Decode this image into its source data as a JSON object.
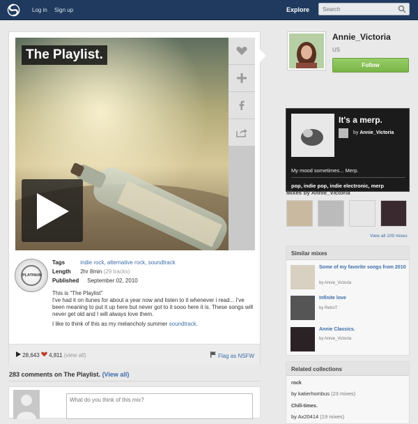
{
  "nav": {
    "login": "Log in",
    "signup": "Sign up",
    "explore": "Explore",
    "search_placeholder": "Search"
  },
  "mix": {
    "title": "The Playlist.",
    "tags_label": "Tags",
    "tags": "indie rock, alternative rock, soundtrack",
    "length_label": "Length",
    "length": "2hr 8min",
    "tracks": "(29 tracks)",
    "published_label": "Published",
    "published": "September 02, 2010",
    "badge": "PLATINUM",
    "desc1": "This is \"The Playlist\"",
    "desc2": "I've had it on itunes for about a year now and listen to it whenever i read... I've been meaning to put it up here but never got to it sooo here it is. These songs will never get old and I will always love them.",
    "desc3_pre": "I like to think of this as my melancholy summer ",
    "desc3_link": "soundtrack",
    "plays": "28,643",
    "likes": "4,811",
    "view_all": "(view all)",
    "flag": "Flag as NSFW"
  },
  "comments": {
    "heading": "283 comments on The Playlist.",
    "view_all": "(View all)",
    "placeholder": "What do you think of this mix?"
  },
  "profile": {
    "name": "Annie_Victoria",
    "location": "US",
    "follow": "Follow"
  },
  "card": {
    "title": "It's a merp.",
    "by": "by",
    "user": "Annie_Victoria",
    "desc": "My mood sometimes... Merp.",
    "tags": "pop, indie pop, indie electronic, merp"
  },
  "mixes_by": {
    "heading": "Mixes by Annie_Victoria",
    "view_all": "View all 109 mixes"
  },
  "similar": {
    "heading": "Similar mixes",
    "items": [
      {
        "title": "Some of my favorite songs from 2010",
        "by": "by Annie_Victoria"
      },
      {
        "title": "Infinite love",
        "by": "by RetroT"
      },
      {
        "title": "Annie Classics.",
        "by": "by Annie_Victoria"
      }
    ]
  },
  "collections": {
    "heading": "Related collections",
    "items": [
      {
        "name": "rock",
        "by": "by katierhombus",
        "count": "(23 mixes)"
      },
      {
        "name": "Chill-times.",
        "by": "by Ax20414",
        "count": "(19 mixes)"
      }
    ]
  },
  "colors": {
    "topbar": "#1f3a5e",
    "follow": "#7ab548",
    "link": "#3b6da8"
  }
}
